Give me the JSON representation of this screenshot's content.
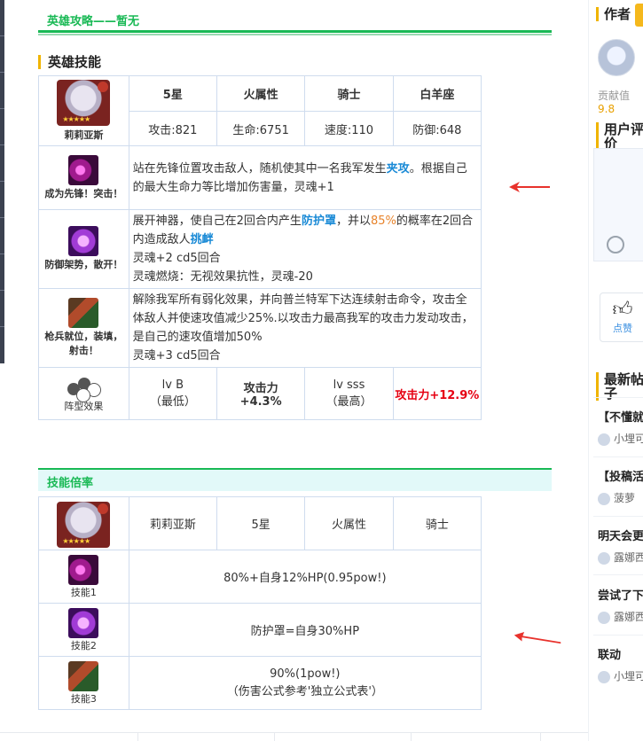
{
  "guide": {
    "title": "英雄攻略——暂无"
  },
  "skills_section": {
    "title": "英雄技能"
  },
  "hero": {
    "name": "莉莉亚斯",
    "stars": "5星",
    "element": "火属性",
    "class": "骑士",
    "constellation": "白羊座",
    "stats": [
      "攻击:821",
      "生命:6751",
      "速度:110",
      "防御:648"
    ]
  },
  "skills": [
    {
      "name": "成为先锋！突击！",
      "desc_parts": [
        "站在先锋位置攻击敌人，随机使其中一名我军发生",
        "夹攻",
        "。根据自己的最大生命力等比增加伤害量，灵魂+1"
      ]
    },
    {
      "name": "防御架势，散开！",
      "desc_parts": [
        "展开神器，使自己在2回合内产生",
        "防护罩",
        "，并以",
        "85%",
        "的概率在2回合内造成敌人",
        "挑衅"
      ],
      "lines": [
        "灵魂+2 cd5回合",
        "灵魂燃烧：无视效果抗性，灵魂-20"
      ]
    },
    {
      "name": "枪兵就位，装填，射击！",
      "desc": "解除我军所有弱化效果，并向普兰特军下达连续射击命令，攻击全体敌人并使速攻值减少25%.以攻击力最高我军的攻击力发动攻击，是自己的速攻值增加50%",
      "lines": [
        "灵魂+3 cd5回合"
      ]
    }
  ],
  "formation": {
    "label": "阵型效果",
    "lvb": "lv B",
    "lvb_sub": "（最低）",
    "atk_label": "攻击力",
    "atk_low": "+4.3%",
    "lvsss": "lv sss",
    "lvsss_sub": "（最高）",
    "atk_high": "攻击力+12.9%"
  },
  "rate_section": {
    "title": "技能倍率"
  },
  "rate_table": {
    "header": [
      "莉莉亚斯",
      "5星",
      "火属性",
      "骑士"
    ],
    "rows": [
      {
        "label": "技能1",
        "value": "80%+自身12%HP(0.95pow!)"
      },
      {
        "label": "技能2",
        "value": "防护罩=自身30%HP"
      },
      {
        "label": "技能3",
        "value": "90%(1pow!)",
        "note": "（伤害公式参考'独立公式表'）"
      }
    ]
  },
  "sidebar": {
    "author_title": "作者",
    "contrib_label": "贡献值",
    "contrib_value": "9.8",
    "rating_title": "用户评价",
    "like_label": "点赞",
    "news_title": "最新帖子",
    "news": [
      {
        "title": "【不懂就问",
        "user": "小埋可"
      },
      {
        "title": "【投稿活动",
        "user": "菠萝"
      },
      {
        "title": "明天会更好",
        "user": "露娜西"
      },
      {
        "title": "尝试了下",
        "user": "露娜西"
      },
      {
        "title": "联动",
        "user": "小埋可"
      }
    ]
  },
  "colors": {
    "accent_green": "#19b955",
    "highlight_blue": "#1a8ad6",
    "highlight_orange": "#e8842c",
    "highlight_red": "#e60012",
    "section_marker": "#f0b400"
  }
}
